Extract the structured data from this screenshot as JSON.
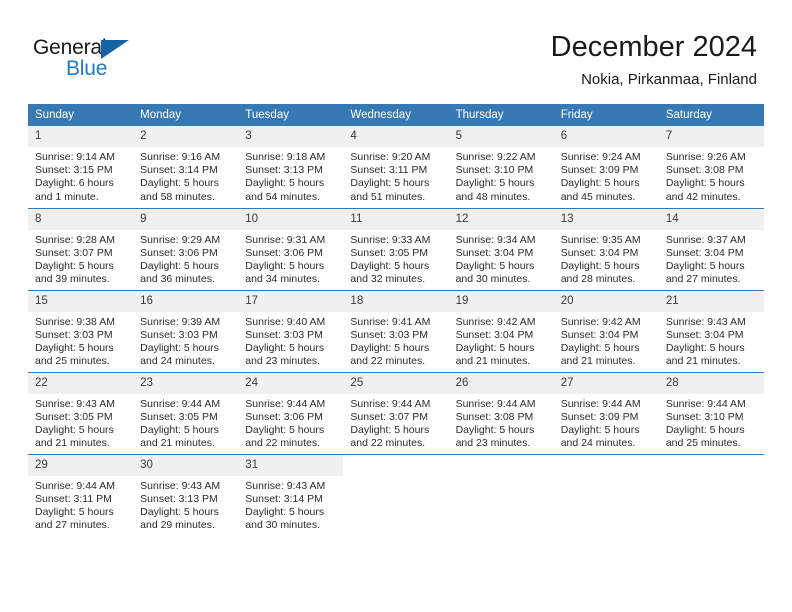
{
  "brand": {
    "name_part1": "General",
    "name_part2": "Blue"
  },
  "header": {
    "title": "December 2024",
    "subtitle": "Nokia, Pirkanmaa, Finland"
  },
  "colors": {
    "header_row_bg": "#3679b5",
    "daynum_bg": "#f0f0f0",
    "brand_blue": "#1e7bc4",
    "logo_triangle": "#1464a5",
    "text": "#2b2b2b"
  },
  "weekday_headers": [
    "Sunday",
    "Monday",
    "Tuesday",
    "Wednesday",
    "Thursday",
    "Friday",
    "Saturday"
  ],
  "labels": {
    "sunrise_prefix": "Sunrise:",
    "sunset_prefix": "Sunset:",
    "daylight_prefix": "Daylight:"
  },
  "weeks": [
    [
      {
        "day": "1",
        "sunrise": "Sunrise: 9:14 AM",
        "sunset": "Sunset: 3:15 PM",
        "daylight_line1": "Daylight: 6 hours",
        "daylight_line2": "and 1 minute."
      },
      {
        "day": "2",
        "sunrise": "Sunrise: 9:16 AM",
        "sunset": "Sunset: 3:14 PM",
        "daylight_line1": "Daylight: 5 hours",
        "daylight_line2": "and 58 minutes."
      },
      {
        "day": "3",
        "sunrise": "Sunrise: 9:18 AM",
        "sunset": "Sunset: 3:13 PM",
        "daylight_line1": "Daylight: 5 hours",
        "daylight_line2": "and 54 minutes."
      },
      {
        "day": "4",
        "sunrise": "Sunrise: 9:20 AM",
        "sunset": "Sunset: 3:11 PM",
        "daylight_line1": "Daylight: 5 hours",
        "daylight_line2": "and 51 minutes."
      },
      {
        "day": "5",
        "sunrise": "Sunrise: 9:22 AM",
        "sunset": "Sunset: 3:10 PM",
        "daylight_line1": "Daylight: 5 hours",
        "daylight_line2": "and 48 minutes."
      },
      {
        "day": "6",
        "sunrise": "Sunrise: 9:24 AM",
        "sunset": "Sunset: 3:09 PM",
        "daylight_line1": "Daylight: 5 hours",
        "daylight_line2": "and 45 minutes."
      },
      {
        "day": "7",
        "sunrise": "Sunrise: 9:26 AM",
        "sunset": "Sunset: 3:08 PM",
        "daylight_line1": "Daylight: 5 hours",
        "daylight_line2": "and 42 minutes."
      }
    ],
    [
      {
        "day": "8",
        "sunrise": "Sunrise: 9:28 AM",
        "sunset": "Sunset: 3:07 PM",
        "daylight_line1": "Daylight: 5 hours",
        "daylight_line2": "and 39 minutes."
      },
      {
        "day": "9",
        "sunrise": "Sunrise: 9:29 AM",
        "sunset": "Sunset: 3:06 PM",
        "daylight_line1": "Daylight: 5 hours",
        "daylight_line2": "and 36 minutes."
      },
      {
        "day": "10",
        "sunrise": "Sunrise: 9:31 AM",
        "sunset": "Sunset: 3:06 PM",
        "daylight_line1": "Daylight: 5 hours",
        "daylight_line2": "and 34 minutes."
      },
      {
        "day": "11",
        "sunrise": "Sunrise: 9:33 AM",
        "sunset": "Sunset: 3:05 PM",
        "daylight_line1": "Daylight: 5 hours",
        "daylight_line2": "and 32 minutes."
      },
      {
        "day": "12",
        "sunrise": "Sunrise: 9:34 AM",
        "sunset": "Sunset: 3:04 PM",
        "daylight_line1": "Daylight: 5 hours",
        "daylight_line2": "and 30 minutes."
      },
      {
        "day": "13",
        "sunrise": "Sunrise: 9:35 AM",
        "sunset": "Sunset: 3:04 PM",
        "daylight_line1": "Daylight: 5 hours",
        "daylight_line2": "and 28 minutes."
      },
      {
        "day": "14",
        "sunrise": "Sunrise: 9:37 AM",
        "sunset": "Sunset: 3:04 PM",
        "daylight_line1": "Daylight: 5 hours",
        "daylight_line2": "and 27 minutes."
      }
    ],
    [
      {
        "day": "15",
        "sunrise": "Sunrise: 9:38 AM",
        "sunset": "Sunset: 3:03 PM",
        "daylight_line1": "Daylight: 5 hours",
        "daylight_line2": "and 25 minutes."
      },
      {
        "day": "16",
        "sunrise": "Sunrise: 9:39 AM",
        "sunset": "Sunset: 3:03 PM",
        "daylight_line1": "Daylight: 5 hours",
        "daylight_line2": "and 24 minutes."
      },
      {
        "day": "17",
        "sunrise": "Sunrise: 9:40 AM",
        "sunset": "Sunset: 3:03 PM",
        "daylight_line1": "Daylight: 5 hours",
        "daylight_line2": "and 23 minutes."
      },
      {
        "day": "18",
        "sunrise": "Sunrise: 9:41 AM",
        "sunset": "Sunset: 3:03 PM",
        "daylight_line1": "Daylight: 5 hours",
        "daylight_line2": "and 22 minutes."
      },
      {
        "day": "19",
        "sunrise": "Sunrise: 9:42 AM",
        "sunset": "Sunset: 3:04 PM",
        "daylight_line1": "Daylight: 5 hours",
        "daylight_line2": "and 21 minutes."
      },
      {
        "day": "20",
        "sunrise": "Sunrise: 9:42 AM",
        "sunset": "Sunset: 3:04 PM",
        "daylight_line1": "Daylight: 5 hours",
        "daylight_line2": "and 21 minutes."
      },
      {
        "day": "21",
        "sunrise": "Sunrise: 9:43 AM",
        "sunset": "Sunset: 3:04 PM",
        "daylight_line1": "Daylight: 5 hours",
        "daylight_line2": "and 21 minutes."
      }
    ],
    [
      {
        "day": "22",
        "sunrise": "Sunrise: 9:43 AM",
        "sunset": "Sunset: 3:05 PM",
        "daylight_line1": "Daylight: 5 hours",
        "daylight_line2": "and 21 minutes."
      },
      {
        "day": "23",
        "sunrise": "Sunrise: 9:44 AM",
        "sunset": "Sunset: 3:05 PM",
        "daylight_line1": "Daylight: 5 hours",
        "daylight_line2": "and 21 minutes."
      },
      {
        "day": "24",
        "sunrise": "Sunrise: 9:44 AM",
        "sunset": "Sunset: 3:06 PM",
        "daylight_line1": "Daylight: 5 hours",
        "daylight_line2": "and 22 minutes."
      },
      {
        "day": "25",
        "sunrise": "Sunrise: 9:44 AM",
        "sunset": "Sunset: 3:07 PM",
        "daylight_line1": "Daylight: 5 hours",
        "daylight_line2": "and 22 minutes."
      },
      {
        "day": "26",
        "sunrise": "Sunrise: 9:44 AM",
        "sunset": "Sunset: 3:08 PM",
        "daylight_line1": "Daylight: 5 hours",
        "daylight_line2": "and 23 minutes."
      },
      {
        "day": "27",
        "sunrise": "Sunrise: 9:44 AM",
        "sunset": "Sunset: 3:09 PM",
        "daylight_line1": "Daylight: 5 hours",
        "daylight_line2": "and 24 minutes."
      },
      {
        "day": "28",
        "sunrise": "Sunrise: 9:44 AM",
        "sunset": "Sunset: 3:10 PM",
        "daylight_line1": "Daylight: 5 hours",
        "daylight_line2": "and 25 minutes."
      }
    ],
    [
      {
        "day": "29",
        "sunrise": "Sunrise: 9:44 AM",
        "sunset": "Sunset: 3:11 PM",
        "daylight_line1": "Daylight: 5 hours",
        "daylight_line2": "and 27 minutes."
      },
      {
        "day": "30",
        "sunrise": "Sunrise: 9:43 AM",
        "sunset": "Sunset: 3:13 PM",
        "daylight_line1": "Daylight: 5 hours",
        "daylight_line2": "and 29 minutes."
      },
      {
        "day": "31",
        "sunrise": "Sunrise: 9:43 AM",
        "sunset": "Sunset: 3:14 PM",
        "daylight_line1": "Daylight: 5 hours",
        "daylight_line2": "and 30 minutes."
      },
      {
        "day": "",
        "sunrise": "",
        "sunset": "",
        "daylight_line1": "",
        "daylight_line2": "",
        "empty": true
      },
      {
        "day": "",
        "sunrise": "",
        "sunset": "",
        "daylight_line1": "",
        "daylight_line2": "",
        "empty": true
      },
      {
        "day": "",
        "sunrise": "",
        "sunset": "",
        "daylight_line1": "",
        "daylight_line2": "",
        "empty": true
      },
      {
        "day": "",
        "sunrise": "",
        "sunset": "",
        "daylight_line1": "",
        "daylight_line2": "",
        "empty": true
      }
    ]
  ]
}
